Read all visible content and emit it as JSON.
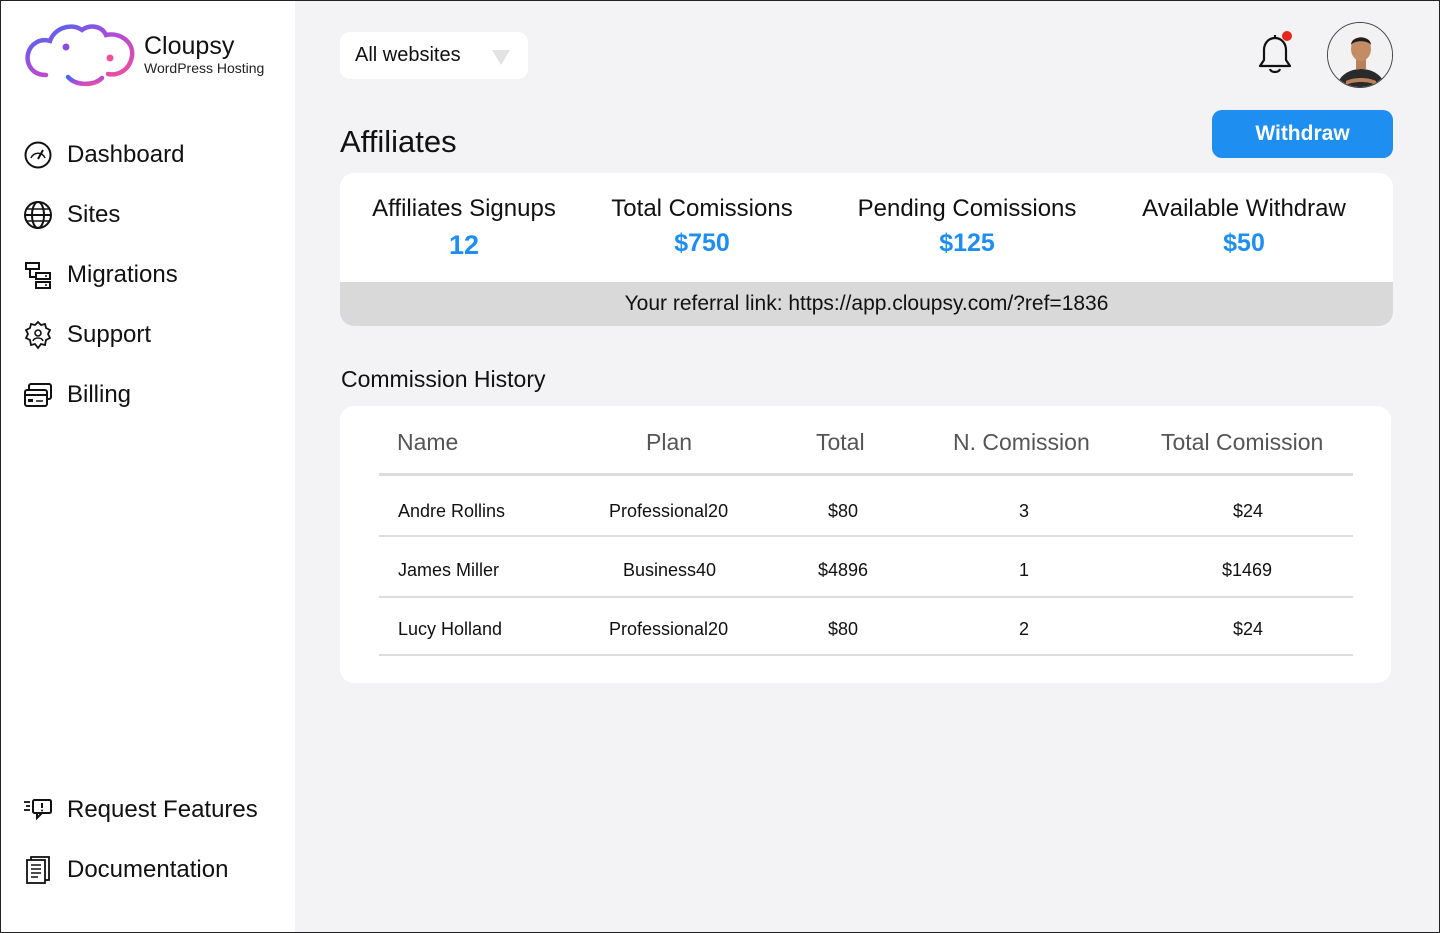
{
  "brand": {
    "name": "Cloupsy",
    "tagline": "WordPress Hosting"
  },
  "sidebar": {
    "items": [
      {
        "label": "Dashboard",
        "icon": "gauge-icon"
      },
      {
        "label": "Sites",
        "icon": "globe-icon"
      },
      {
        "label": "Migrations",
        "icon": "server-transfer-icon"
      },
      {
        "label": "Support",
        "icon": "gear-user-icon"
      },
      {
        "label": "Billing",
        "icon": "credit-card-icon"
      }
    ],
    "bottom_items": [
      {
        "label": "Request Features",
        "icon": "feedback-icon"
      },
      {
        "label": "Documentation",
        "icon": "document-icon"
      }
    ]
  },
  "header": {
    "site_select": "All websites",
    "notification_dot_color": "#e8261c"
  },
  "page": {
    "title": "Affiliates",
    "withdraw_label": "Withdraw",
    "accent_color": "#1e8ef0"
  },
  "stats": [
    {
      "label": "Affiliates Signups",
      "value": "12"
    },
    {
      "label": "Total Comissions",
      "value": "$750"
    },
    {
      "label": "Pending Comissions",
      "value": "$125"
    },
    {
      "label": "Available Withdraw",
      "value": "$50"
    }
  ],
  "referral": {
    "text": "Your referral link: https://app.cloupsy.com/?ref=1836"
  },
  "history": {
    "title": "Commission History",
    "columns": [
      "Name",
      "Plan",
      "Total",
      "N. Comission",
      "Total Comission"
    ],
    "rows": [
      [
        "Andre Rollins",
        "Professional20",
        "$80",
        "3",
        "$24"
      ],
      [
        "James Miller",
        "Business40",
        "$4896",
        "1",
        "$1469"
      ],
      [
        "Lucy Holland",
        "Professional20",
        "$80",
        "2",
        "$24"
      ]
    ]
  }
}
